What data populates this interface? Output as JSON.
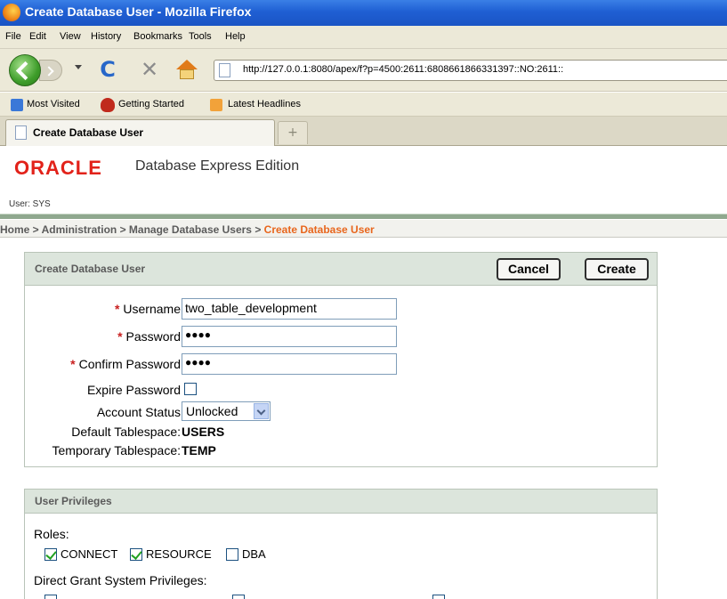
{
  "window": {
    "title": "Create Database User - Mozilla Firefox"
  },
  "menu": [
    "File",
    "Edit",
    "View",
    "History",
    "Bookmarks",
    "Tools",
    "Help"
  ],
  "nav": {
    "url": "http://127.0.0.1:8080/apex/f?p=4500:2611:6808661866331397::NO:2611::"
  },
  "bookmarks": [
    "Most Visited",
    "Getting Started",
    "Latest Headlines"
  ],
  "tabs": {
    "active": "Create Database User",
    "new_tab_symbol": "+"
  },
  "header": {
    "logo": "ORACLE",
    "edition": "Database Express Edition",
    "user": "User: SYS"
  },
  "breadcrumb": {
    "path": "Home > Administration > Manage Database Users > ",
    "current": "Create Database User"
  },
  "user_region": {
    "title": "Create Database User",
    "cancel": "Cancel",
    "create": "Create",
    "username_label": "Username",
    "username_value": "two_table_development",
    "password_label": "Password",
    "password_value": "●●●●",
    "confirm_label": "Confirm Password",
    "confirm_value": "●●●●",
    "expire_label": "Expire Password",
    "status_label": "Account Status",
    "status_value": "Unlocked",
    "default_ts_label": "Default Tablespace:",
    "default_ts_value": "USERS",
    "temp_ts_label": "Temporary Tablespace:",
    "temp_ts_value": "TEMP",
    "required_mark": "*"
  },
  "priv_region": {
    "title": "User Privileges",
    "roles_label": "Roles:",
    "roles": [
      {
        "label": "CONNECT",
        "checked": true
      },
      {
        "label": "RESOURCE",
        "checked": true
      },
      {
        "label": "DBA",
        "checked": false
      }
    ],
    "direct_label": "Direct Grant System Privileges:"
  }
}
